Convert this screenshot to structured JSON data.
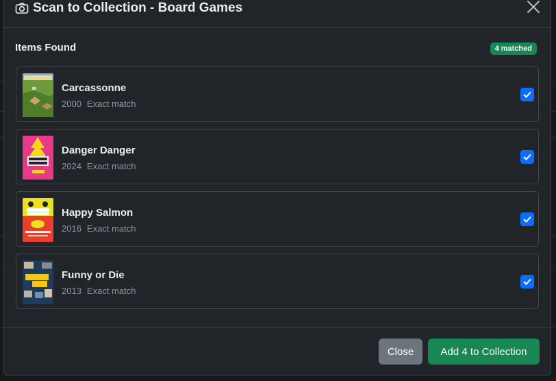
{
  "modal": {
    "title": "Scan to Collection - Board Games",
    "title_icon": "camera-icon",
    "close_icon": "close-icon"
  },
  "section": {
    "title": "Items Found",
    "badge": "4 matched",
    "badge_color": "#198754"
  },
  "items": [
    {
      "name": "Carcassonne",
      "year": "2000",
      "match": "Exact match",
      "checked": true,
      "cover": "carcassonne-cover"
    },
    {
      "name": "Danger Danger",
      "year": "2024",
      "match": "Exact match",
      "checked": true,
      "cover": "danger-danger-cover"
    },
    {
      "name": "Happy Salmon",
      "year": "2016",
      "match": "Exact match",
      "checked": true,
      "cover": "happy-salmon-cover"
    },
    {
      "name": "Funny or Die",
      "year": "2013",
      "match": "Exact match",
      "checked": true,
      "cover": "funny-or-die-cover"
    }
  ],
  "footer": {
    "close_label": "Close",
    "add_label": "Add 4 to Collection"
  },
  "colors": {
    "primary": "#0d6efd",
    "success": "#198754",
    "secondary": "#6c757d"
  }
}
